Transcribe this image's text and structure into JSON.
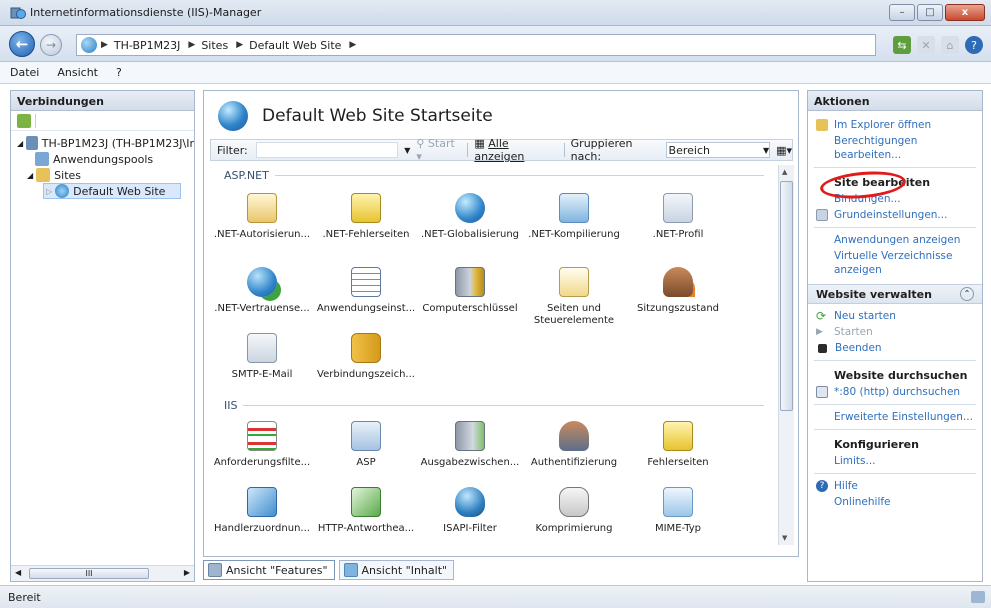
{
  "window": {
    "title": "Internetinformationsdienste (IIS)-Manager",
    "buttons": {
      "minimize": "–",
      "maximize": "□",
      "close": "x"
    }
  },
  "nav": {
    "back": "←",
    "forward": "→",
    "breadcrumbs": [
      "TH-BP1M23J",
      "Sites",
      "Default Web Site"
    ]
  },
  "menu": {
    "items": [
      "Datei",
      "Ansicht",
      "?"
    ]
  },
  "connections": {
    "header": "Verbindungen",
    "tree": [
      {
        "label": "TH-BP1M23J (TH-BP1M23J\\Ir",
        "level": 0
      },
      {
        "label": "Anwendungspools",
        "level": 1
      },
      {
        "label": "Sites",
        "level": 1
      },
      {
        "label": "Default Web Site",
        "level": 2
      }
    ],
    "scroll_label": "III"
  },
  "main": {
    "title": "Default Web Site Startseite",
    "filter": {
      "label": "Filter:",
      "start": "Start",
      "show_all": "Alle anzeigen",
      "group_by_label": "Gruppieren nach:",
      "group_by_value": "Bereich"
    },
    "groups": [
      {
        "name": "ASP.NET",
        "features": [
          {
            "label": ".NET-Autorisierun...",
            "icon": "lock-document-icon"
          },
          {
            "label": ".NET-Fehlerseiten",
            "icon": "warning-404-icon"
          },
          {
            "label": ".NET-Globalisierung",
            "icon": "globe-icon"
          },
          {
            "label": ".NET-Kompilierung",
            "icon": "compile-icon"
          },
          {
            "label": ".NET-Profil",
            "icon": "profile-icon"
          },
          {
            "label": ".NET-Vertrauense...",
            "icon": "trust-icon"
          },
          {
            "label": "Anwendungseinst...",
            "icon": "settings-list-icon"
          },
          {
            "label": "Computerschlüssel",
            "icon": "machine-key-icon"
          },
          {
            "label": "Seiten und Steuerelemente",
            "icon": "pages-controls-icon"
          },
          {
            "label": "Sitzungszustand",
            "icon": "session-state-icon"
          },
          {
            "label": "SMTP-E-Mail",
            "icon": "smtp-mail-icon"
          },
          {
            "label": "Verbindungszeich...",
            "icon": "connection-string-icon"
          }
        ]
      },
      {
        "name": "IIS",
        "features": [
          {
            "label": "Anforderungsfilte...",
            "icon": "request-filter-icon"
          },
          {
            "label": "ASP",
            "icon": "asp-icon"
          },
          {
            "label": "Ausgabezwischen...",
            "icon": "output-cache-icon"
          },
          {
            "label": "Authentifizierung",
            "icon": "authentication-icon"
          },
          {
            "label": "Fehlerseiten",
            "icon": "error-pages-icon"
          },
          {
            "label": "Handlerzuordnun...",
            "icon": "handler-mapping-icon"
          },
          {
            "label": "HTTP-Antworthea...",
            "icon": "http-headers-icon"
          },
          {
            "label": "ISAPI-Filter",
            "icon": "isapi-filter-icon"
          },
          {
            "label": "Komprimierung",
            "icon": "compression-icon"
          },
          {
            "label": "MIME-Typ",
            "icon": "mime-type-icon"
          }
        ]
      }
    ],
    "view_tabs": [
      "Ansicht \"Features\"",
      "Ansicht \"Inhalt\""
    ]
  },
  "actions": {
    "header": "Aktionen",
    "open_explorer": "Im Explorer öffnen",
    "edit_permissions": "Berechtigungen bearbeiten...",
    "site_edit_header": "Site bearbeiten",
    "bindings": "Bindungen...",
    "basic_settings": "Grundeinstellungen...",
    "view_apps": "Anwendungen anzeigen",
    "view_virtual_dirs": "Virtuelle Verzeichnisse anzeigen",
    "manage_header": "Website verwalten",
    "restart": "Neu starten",
    "start": "Starten",
    "stop": "Beenden",
    "browse_header": "Website durchsuchen",
    "browse_http": "*:80 (http) durchsuchen",
    "advanced_settings": "Erweiterte Einstellungen...",
    "configure_header": "Konfigurieren",
    "limits": "Limits...",
    "help": "Hilfe",
    "online_help": "Onlinehilfe"
  },
  "status": {
    "text": "Bereit"
  },
  "colors": {
    "link": "#2f6fbd",
    "highlight": "#e21a1a"
  }
}
